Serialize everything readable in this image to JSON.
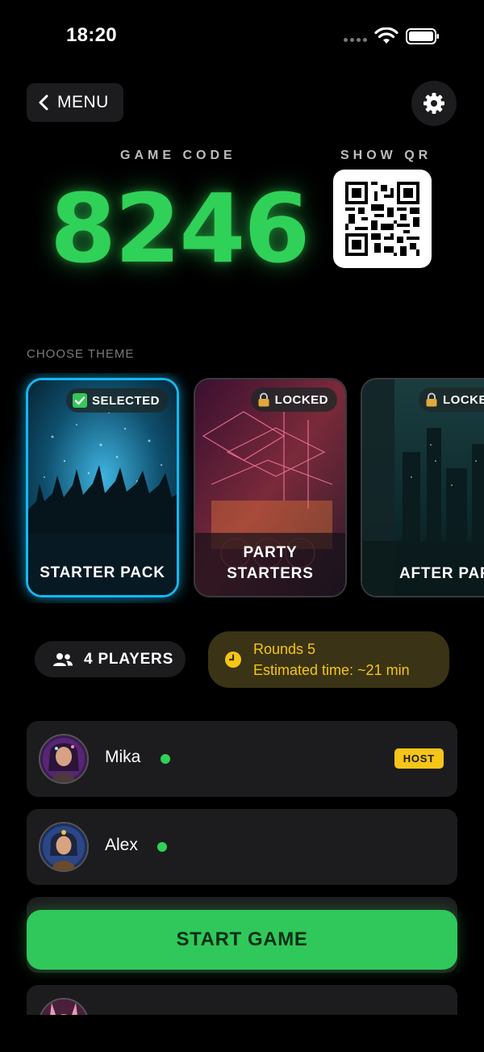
{
  "status_bar": {
    "time": "18:20",
    "icons": [
      "signal-dots-icon",
      "wifi-icon",
      "battery-icon"
    ]
  },
  "header": {
    "menu_label": "MENU",
    "menu_icon": "chevron-left-icon",
    "settings_icon": "gear-icon"
  },
  "game_code": {
    "label": "GAME CODE",
    "value": "8246",
    "color": "#30d158"
  },
  "qr": {
    "label": "SHOW QR",
    "icon": "qr-code-icon"
  },
  "themes": {
    "heading": "CHOOSE THEME",
    "items": [
      {
        "title": "STARTER PACK",
        "badge": "SELECTED",
        "badge_icon": "check-icon",
        "selected": true
      },
      {
        "title": "PARTY STARTERS",
        "title_line1": "PARTY",
        "title_line2": "STARTERS",
        "badge": "LOCKED",
        "badge_icon": "lock-icon",
        "selected": false
      },
      {
        "title": "AFTER PART",
        "badge": "LOCKE",
        "badge_icon": "lock-icon",
        "selected": false
      }
    ]
  },
  "info": {
    "players_label": "4 PLAYERS",
    "players_icon": "users-icon",
    "rounds_label": "Rounds 5",
    "estimate_label": "Estimated time: ~21 min",
    "clock_icon": "clock-icon",
    "accent": "#f5c518"
  },
  "players": [
    {
      "name": "Mika",
      "online": true,
      "host_label": "HOST"
    },
    {
      "name": "Alex",
      "online": true
    }
  ],
  "start_button": {
    "label": "START GAME",
    "color": "#30c85a"
  }
}
